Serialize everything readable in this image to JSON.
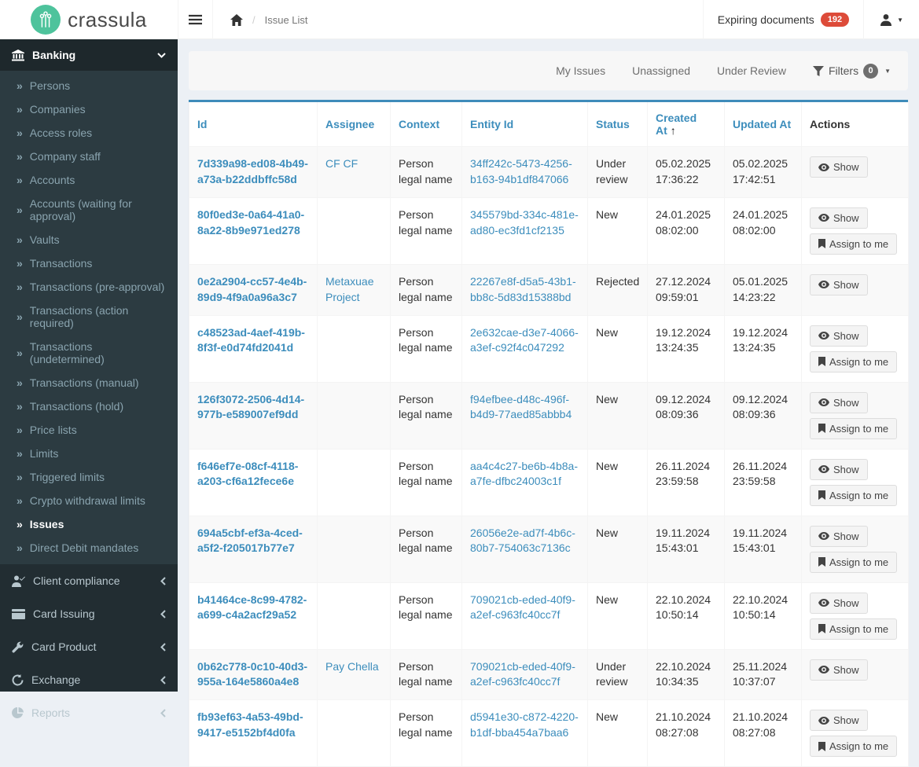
{
  "brand": {
    "name": "crassula",
    "logo_color": "#4ec39c"
  },
  "header": {
    "breadcrumb_sep": "/",
    "breadcrumb_current": "Issue List",
    "expiring_documents_label": "Expiring documents",
    "expiring_documents_count": "192"
  },
  "sidebar": {
    "banking": {
      "label": "Banking",
      "items": [
        {
          "label": "Persons"
        },
        {
          "label": "Companies"
        },
        {
          "label": "Access roles"
        },
        {
          "label": "Company staff"
        },
        {
          "label": "Accounts"
        },
        {
          "label": "Accounts (waiting for approval)"
        },
        {
          "label": "Vaults"
        },
        {
          "label": "Transactions"
        },
        {
          "label": "Transactions (pre-approval)"
        },
        {
          "label": "Transactions (action required)"
        },
        {
          "label": "Transactions (undetermined)"
        },
        {
          "label": "Transactions (manual)"
        },
        {
          "label": "Transactions (hold)"
        },
        {
          "label": "Price lists"
        },
        {
          "label": "Limits"
        },
        {
          "label": "Triggered limits"
        },
        {
          "label": "Crypto withdrawal limits"
        },
        {
          "label": "Issues",
          "active": true
        },
        {
          "label": "Direct Debit mandates"
        }
      ],
      "bullet": "»"
    },
    "sections": [
      {
        "label": "Client compliance"
      },
      {
        "label": "Card Issuing"
      },
      {
        "label": "Card Product"
      },
      {
        "label": "Exchange"
      },
      {
        "label": "Reports"
      }
    ]
  },
  "filterbar": {
    "links": [
      {
        "label": "My Issues"
      },
      {
        "label": "Unassigned"
      },
      {
        "label": "Under Review"
      }
    ],
    "filters_label": "Filters",
    "filters_count": "0"
  },
  "table": {
    "columns": {
      "id": "Id",
      "assignee": "Assignee",
      "context": "Context",
      "entity_id": "Entity Id",
      "status": "Status",
      "created_at": "Created At",
      "updated_at": "Updated At",
      "actions": "Actions"
    },
    "sort": {
      "column": "Created At",
      "direction": "asc",
      "arrow": "↑"
    },
    "actions": {
      "show_label": "Show",
      "assign_label": "Assign to me"
    },
    "rows": [
      {
        "id": "7d339a98-ed08-4b49-a73a-b22ddbffc58d",
        "assignee": "CF CF",
        "context": "Person legal name",
        "entity_id": "34ff242c-5473-4256-b163-94b1df847066",
        "status": "Under review",
        "created_at": "05.02.2025 17:36:22",
        "updated_at": "05.02.2025 17:42:51"
      },
      {
        "id": "80f0ed3e-0a64-41a0-8a22-8b9e971ed278",
        "assignee": "",
        "context": "Person legal name",
        "entity_id": "345579bd-334c-481e-ad80-ec3fd1cf2135",
        "status": "New",
        "created_at": "24.01.2025 08:02:00",
        "updated_at": "24.01.2025 08:02:00"
      },
      {
        "id": "0e2a2904-cc57-4e4b-89d9-4f9a0a96a3c7",
        "assignee": "Metaxuae Project",
        "context": "Person legal name",
        "entity_id": "22267e8f-d5a5-43b1-bb8c-5d83d15388bd",
        "status": "Rejected",
        "created_at": "27.12.2024 09:59:01",
        "updated_at": "05.01.2025 14:23:22"
      },
      {
        "id": "c48523ad-4aef-419b-8f3f-e0d74fd2041d",
        "assignee": "",
        "context": "Person legal name",
        "entity_id": "2e632cae-d3e7-4066-a3ef-c92f4c047292",
        "status": "New",
        "created_at": "19.12.2024 13:24:35",
        "updated_at": "19.12.2024 13:24:35"
      },
      {
        "id": "126f3072-2506-4d14-977b-e589007ef9dd",
        "assignee": "",
        "context": "Person legal name",
        "entity_id": "f94efbee-d48c-496f-b4d9-77aed85abbb4",
        "status": "New",
        "created_at": "09.12.2024 08:09:36",
        "updated_at": "09.12.2024 08:09:36"
      },
      {
        "id": "f646ef7e-08cf-4118-a203-cf6a12fece6e",
        "assignee": "",
        "context": "Person legal name",
        "entity_id": "aa4c4c27-be6b-4b8a-a7fe-dfbc24003c1f",
        "status": "New",
        "created_at": "26.11.2024 23:59:58",
        "updated_at": "26.11.2024 23:59:58"
      },
      {
        "id": "694a5cbf-ef3a-4ced-a5f2-f205017b77e7",
        "assignee": "",
        "context": "Person legal name",
        "entity_id": "26056e2e-ad7f-4b6c-80b7-754063c7136c",
        "status": "New",
        "created_at": "19.11.2024 15:43:01",
        "updated_at": "19.11.2024 15:43:01"
      },
      {
        "id": "b41464ce-8c99-4782-a699-c4a2acf29a52",
        "assignee": "",
        "context": "Person legal name",
        "entity_id": "709021cb-eded-40f9-a2ef-c963fc40cc7f",
        "status": "New",
        "created_at": "22.10.2024 10:50:14",
        "updated_at": "22.10.2024 10:50:14"
      },
      {
        "id": "0b62c778-0c10-40d3-955a-164e5860a4e8",
        "assignee": "Pay Chella",
        "context": "Person legal name",
        "entity_id": "709021cb-eded-40f9-a2ef-c963fc40cc7f",
        "status": "Under review",
        "created_at": "22.10.2024 10:34:35",
        "updated_at": "25.11.2024 10:37:07"
      },
      {
        "id": "fb93ef63-4a53-49bd-9417-e5152bf4d0fa",
        "assignee": "",
        "context": "Person legal name",
        "entity_id": "d5941e30-c872-4220-b1df-bba454a7baa6",
        "status": "New",
        "created_at": "21.10.2024 08:27:08",
        "updated_at": "21.10.2024 08:27:08"
      }
    ]
  }
}
